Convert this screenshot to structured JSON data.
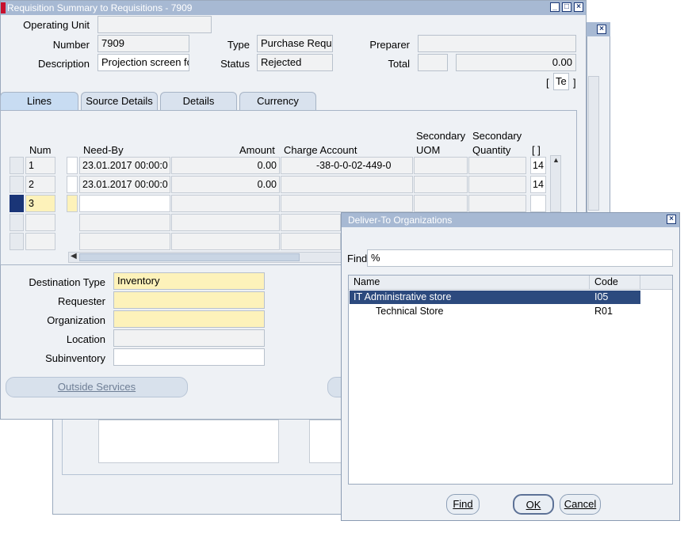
{
  "main_window": {
    "title": "Requisition Summary to Requisitions - 7909",
    "min": "_",
    "max": "□",
    "close": "×"
  },
  "header": {
    "operating_unit_label": "Operating Unit",
    "operating_unit_value": "",
    "number_label": "Number",
    "number_value": "7909",
    "type_label": "Type",
    "type_value": "Purchase Requi",
    "preparer_label": "Preparer",
    "preparer_value": "",
    "description_label": "Description",
    "description_value": "Projection screen fo",
    "status_label": "Status",
    "status_value": "Rejected",
    "total_label": "Total",
    "total_currency": "",
    "total_value": "0.00",
    "folder_bracket_left": "[",
    "folder_value": "Te",
    "folder_bracket_right": "]"
  },
  "tabs": [
    {
      "label": "Lines"
    },
    {
      "label": "Source Details"
    },
    {
      "label": "Details"
    },
    {
      "label": "Currency"
    }
  ],
  "lines_table": {
    "headers": {
      "num": "Num",
      "need_by": "Need-By",
      "amount": "Amount",
      "charge_account": "Charge Account",
      "secondary_uom_1": "Secondary",
      "secondary_uom_2": "UOM",
      "secondary_qty_1": "Secondary",
      "secondary_qty_2": "Quantity",
      "folder": "[ ]"
    },
    "rows": [
      {
        "num": "1",
        "need_by": "23.01.2017 00:00:0",
        "amount": "0.00",
        "charge_account": "-38-0-0-02-449-0",
        "extra": "14"
      },
      {
        "num": "2",
        "need_by": "23.01.2017 00:00:0",
        "amount": "0.00",
        "charge_account": "",
        "extra": "14"
      },
      {
        "num": "3",
        "need_by": "",
        "amount": "",
        "charge_account": "",
        "extra": ""
      }
    ]
  },
  "details": {
    "destination_type_label": "Destination Type",
    "destination_type_value": "Inventory",
    "requester_label": "Requester",
    "requester_value": "",
    "organization_label": "Organization",
    "organization_value": "",
    "location_label": "Location",
    "location_value": "",
    "subinventory_label": "Subinventory",
    "subinventory_value": "",
    "outside_services_label": "Outside Services"
  },
  "lov_dialog": {
    "title": "Deliver-To Organizations",
    "find_label": "Find",
    "find_value": "%",
    "col_name": "Name",
    "col_code": "Code",
    "rows": [
      {
        "name": "IT Administrative store",
        "code": "I05"
      },
      {
        "name": "Technical Store",
        "code": "R01"
      }
    ],
    "find_button": "Find",
    "ok_button": "OK",
    "cancel_button": "Cancel",
    "close": "×"
  },
  "colors": {
    "title_active": "#2e4f8f",
    "title_inactive": "#a7b9d3",
    "selection": "#2c4a7e",
    "required_field": "#fdf2ba"
  }
}
